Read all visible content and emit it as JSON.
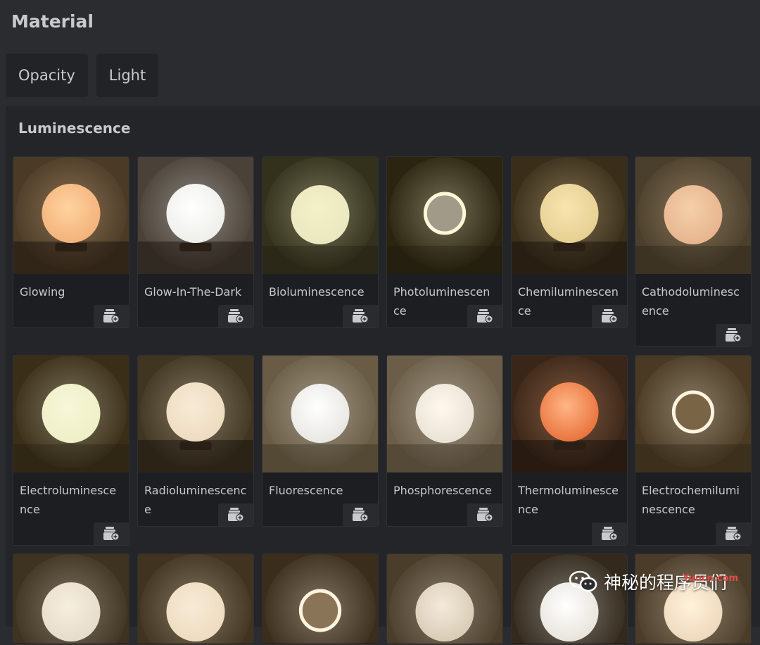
{
  "header": {
    "title": "Material"
  },
  "tabs": [
    {
      "label": "Opacity"
    },
    {
      "label": "Light"
    }
  ],
  "section": {
    "title": "Luminescence"
  },
  "cards": [
    {
      "label": "Glowing",
      "bg": "#4a3a26",
      "orb": "#f3b27a",
      "glow": "#ffd3a0",
      "style": "lamp"
    },
    {
      "label": "Glow-In-The-Dark",
      "bg": "#4a4238",
      "orb": "#eeeeea",
      "glow": "#ffffff",
      "style": "lamp"
    },
    {
      "label": "Bioluminescence",
      "bg": "#33301c",
      "orb": "#eae8c0",
      "glow": "#f4f0c8",
      "style": "plain"
    },
    {
      "label": "Photoluminescence",
      "bg": "#2a2410",
      "orb": "#a29a88",
      "glow": "#fff6d8",
      "style": "ring"
    },
    {
      "label": "Chemiluminescence",
      "bg": "#3a2e1a",
      "orb": "#e6d092",
      "glow": "#f8e4b0",
      "style": "lamp"
    },
    {
      "label": "Cathodoluminescence",
      "bg": "#4a3f2c",
      "orb": "#e7b58e",
      "glow": "#f4cfa9",
      "style": "plain"
    },
    {
      "label": "Electroluminescence",
      "bg": "#3a2e18",
      "orb": "#eef0c8",
      "glow": "#f8f6d8",
      "style": "plain"
    },
    {
      "label": "Radioluminescence",
      "bg": "#3f3521",
      "orb": "#eedcc0",
      "glow": "#f7ead6",
      "style": "lamp"
    },
    {
      "label": "Fluorescence",
      "bg": "#6a5c44",
      "orb": "#e8e7e2",
      "glow": "#ffffff",
      "style": "plain"
    },
    {
      "label": "Phosphorescence",
      "bg": "#6b5d48",
      "orb": "#e9e3d6",
      "glow": "#fff8ec",
      "style": "plain"
    },
    {
      "label": "Thermoluminescence",
      "bg": "#3a2618",
      "orb": "#e9743e",
      "glow": "#ffb585",
      "style": "lamp"
    },
    {
      "label": "Electrochemiluminescence",
      "bg": "#4a3a23",
      "orb": "#7a6446",
      "glow": "#fff4de",
      "style": "ring"
    },
    {
      "label": "",
      "bg": "#3e3220",
      "orb": "#e6dccc",
      "glow": "#f6eede",
      "style": "plain"
    },
    {
      "label": "",
      "bg": "#40331f",
      "orb": "#eedcc0",
      "glow": "#f7ead6",
      "style": "plain"
    },
    {
      "label": "",
      "bg": "#3a2d1c",
      "orb": "#8a7458",
      "glow": "#fff4de",
      "style": "ring"
    },
    {
      "label": "",
      "bg": "#4a3e2b",
      "orb": "#d8ccb6",
      "glow": "#f4eadb",
      "style": "plain"
    },
    {
      "label": "",
      "bg": "#33291c",
      "orb": "#e8e4dc",
      "glow": "#ffffff",
      "style": "plain"
    },
    {
      "label": "",
      "bg": "#4a3c28",
      "orb": "#eed9bc",
      "glow": "#fff2dc",
      "style": "plain"
    }
  ],
  "icons": {
    "add_to_collection": "add-to-collection-icon"
  },
  "watermark": {
    "text": "神秘的程序员们",
    "url": "Yuucn.com"
  }
}
